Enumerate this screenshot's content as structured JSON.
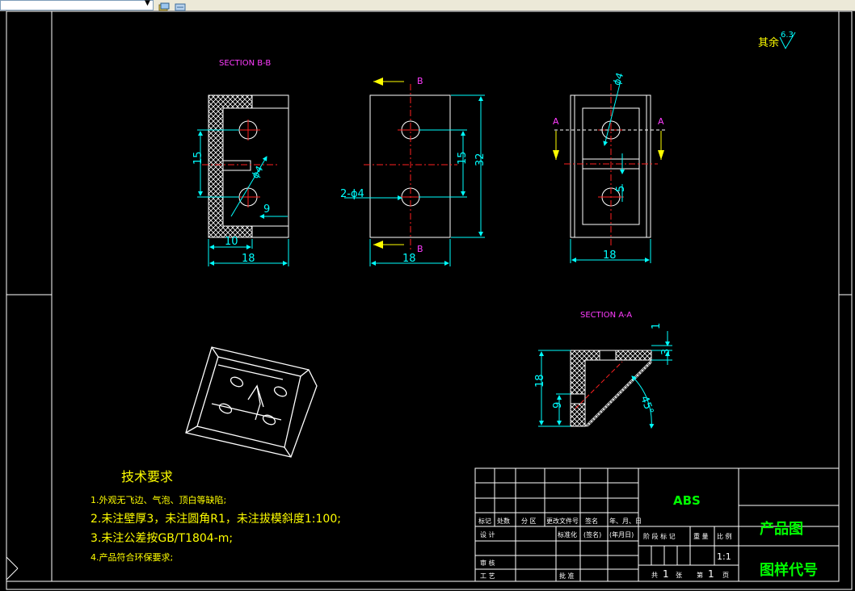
{
  "toolbar": {
    "layer_combo_value": "",
    "icons": [
      "layer-states-icon",
      "layer-previous-icon"
    ]
  },
  "views": {
    "section_bb_title": "SECTION B-B",
    "section_aa_title": "SECTION A-A",
    "section_bb": {
      "dim_15": "15",
      "dim_phi4": "ϕ4",
      "dim_9": "9",
      "dim_10": "10",
      "dim_18": "18"
    },
    "front": {
      "label_b_top": "B",
      "label_b_bottom": "B",
      "dim_holes": "2-ϕ4",
      "dim_15": "15",
      "dim_32": "32",
      "dim_18": "18"
    },
    "right": {
      "label_a_left": "A",
      "label_a_right": "A",
      "dim_phi4": "ϕ4",
      "dim_5": "5",
      "dim_18": "18"
    },
    "section_aa": {
      "dim_1": "1",
      "dim_3": "3",
      "dim_18": "18",
      "dim_9": "9",
      "dim_45": "45°"
    }
  },
  "roughness": {
    "prefix": "其余",
    "value": "6.3"
  },
  "tech_requirements": {
    "title": "技术要求",
    "items": [
      "1.外观无飞边、气泡、顶白等缺陷;",
      "2.未注壁厚3，未注圆角R1，未注拔模斜度1:100;",
      "3.未注公差按GB/T1804-m;",
      "4.产品符合环保要求;"
    ]
  },
  "title_block": {
    "material": "ABS",
    "drawing_name": "产品图",
    "drawing_code": "图样代号",
    "scale": "1:1",
    "rev_headers": [
      "标记",
      "处数",
      "分  区",
      "更改文件号",
      "签名",
      "年、月、日"
    ],
    "design_row": [
      "设  计",
      "标准化",
      "(签名)",
      "(年月日)"
    ],
    "stage_headers": [
      "阶  段  标  记",
      "重  量",
      "比  例"
    ],
    "review": "审  核",
    "process": "工  艺",
    "approve": "批  准",
    "sheet_total_pre": "共",
    "sheet_total": "1",
    "sheet_total_post": "张",
    "sheet_num_pre": "第",
    "sheet_num": "1",
    "sheet_num_post": "页"
  },
  "colors": {
    "outline": "#ffffff",
    "center_line": "#ff2020",
    "dimension": "#00ffff",
    "section_label": "#ff3cff",
    "tech_text": "#ffff00",
    "title_text": "#00ff00",
    "hatch": "#ffffff"
  }
}
